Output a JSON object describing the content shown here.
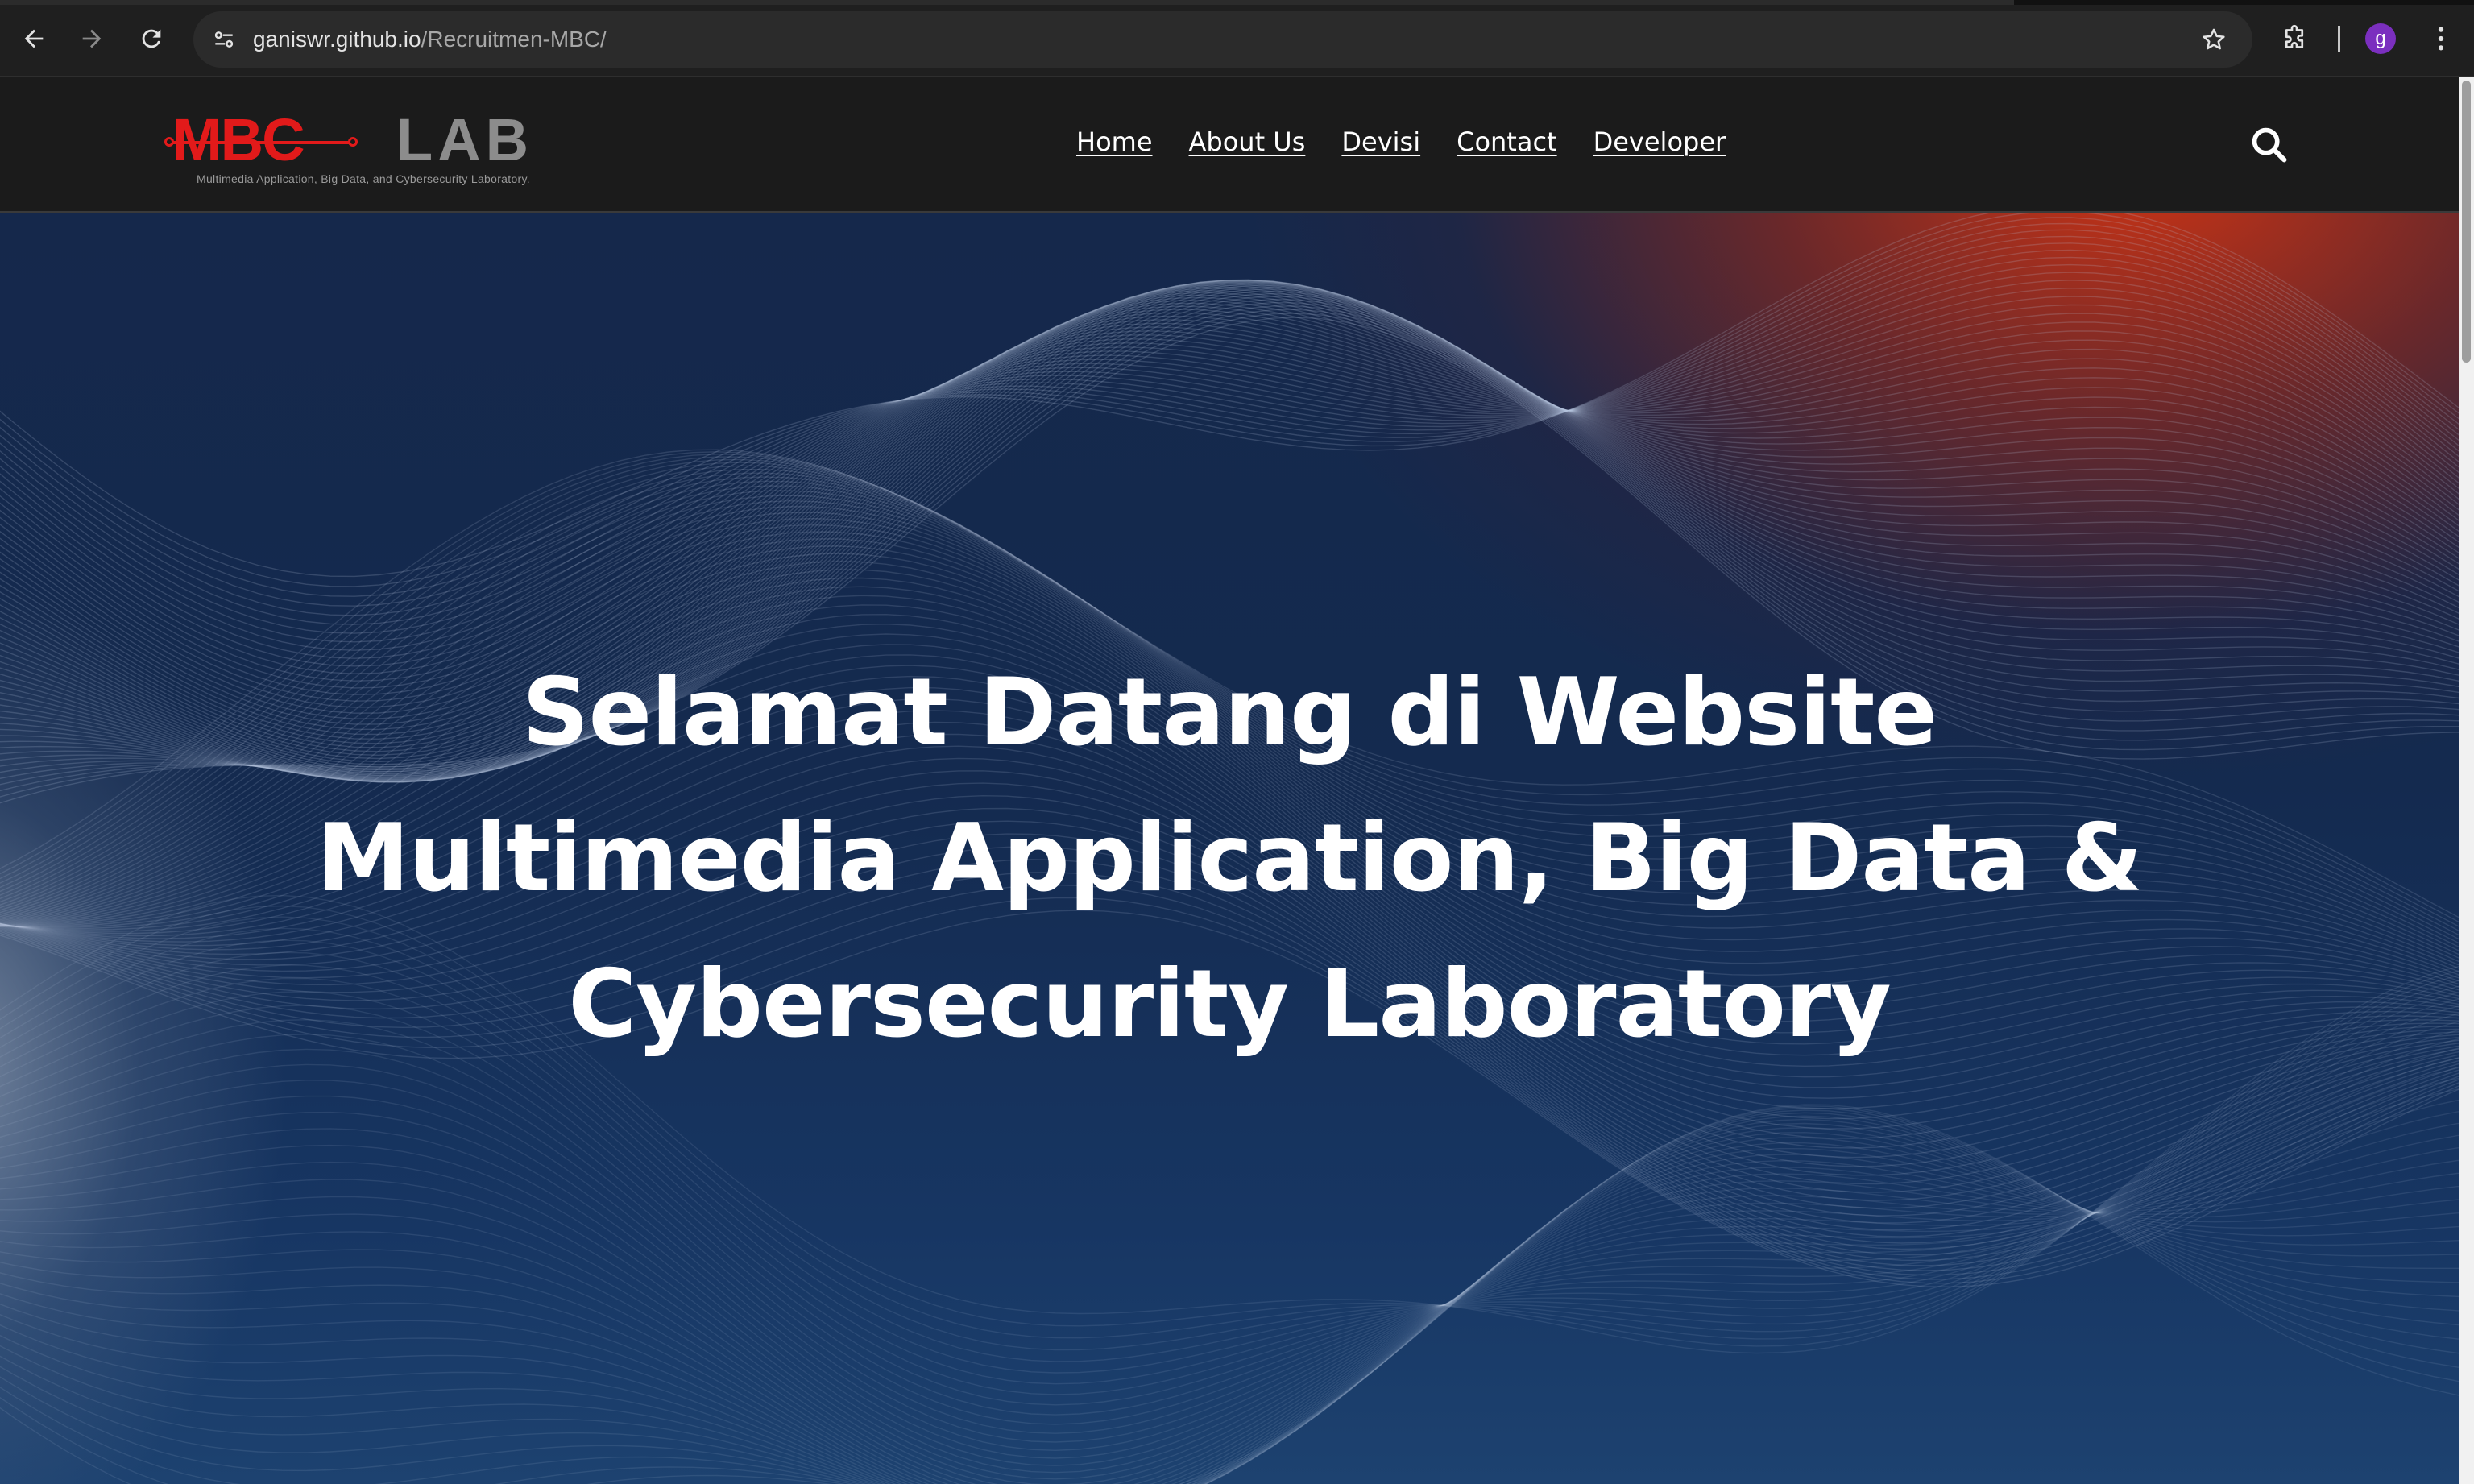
{
  "browser": {
    "url_domain": "ganiswr.github.io",
    "url_path": "/Recruitmen-MBC/",
    "profile_initial": "g",
    "icons": [
      "back-arrow-icon",
      "forward-arrow-icon",
      "reload-icon",
      "site-info-icon",
      "star-icon",
      "extensions-icon",
      "kebab-menu-icon"
    ]
  },
  "header": {
    "logo_main": "MBC",
    "logo_secondary": "LAB",
    "logo_tagline": "Multimedia  Application, Big Data, and Cybersecurity Laboratory.",
    "nav": [
      "Home",
      "About Us",
      "Devisi",
      "Contact",
      "Developer"
    ],
    "search_icon": "search-icon"
  },
  "hero": {
    "title_line1": "Selamat Datang di Website",
    "title_line2": "Multimedia Application, Big Data &",
    "title_line3": "Cybersecurity Laboratory"
  },
  "colors": {
    "chrome_bg": "#1f1f1f",
    "header_bg": "#1b1b1b",
    "logo_red": "#e21a1a",
    "logo_gray": "#8c8c8c",
    "hero_navy": "#15284b",
    "hero_orange": "#d63412",
    "profile_purple": "#7b2fbf"
  }
}
